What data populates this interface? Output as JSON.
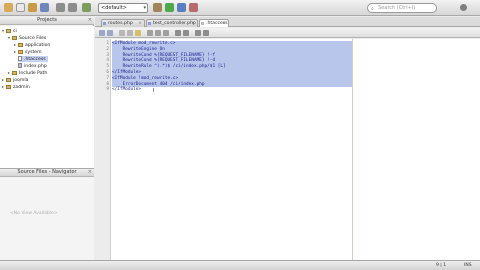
{
  "toolbar": {
    "config_select": "<default>",
    "search_placeholder": "Search (Ctrl+I)"
  },
  "projects_panel": {
    "title": "Projects",
    "tree": [
      {
        "label": "ci",
        "kind": "project",
        "depth": 0,
        "expanded": true
      },
      {
        "label": "Source Files",
        "kind": "folder",
        "depth": 1,
        "expanded": true
      },
      {
        "label": "application",
        "kind": "folder",
        "depth": 2,
        "expanded": false
      },
      {
        "label": "system",
        "kind": "folder",
        "depth": 2,
        "expanded": false
      },
      {
        "label": ".htaccess",
        "kind": "file",
        "depth": 2,
        "selected": true
      },
      {
        "label": "index.php",
        "kind": "file",
        "depth": 2
      },
      {
        "label": "Include Path",
        "kind": "folder",
        "depth": 1,
        "expanded": false
      },
      {
        "label": "joomla",
        "kind": "project",
        "depth": 0,
        "expanded": false
      },
      {
        "label": "zadmin",
        "kind": "project",
        "depth": 0,
        "expanded": false
      }
    ]
  },
  "navigator_panel": {
    "title": "Source Files - Navigator",
    "empty_text": "<No View Available>"
  },
  "tabs": [
    {
      "label": "routes.php",
      "active": false
    },
    {
      "label": "test_controller.php",
      "active": false
    },
    {
      "label": ".htaccess",
      "active": true
    }
  ],
  "editor": {
    "line_numbers": [
      "1",
      "2",
      "3",
      "4",
      "5",
      "6",
      "7",
      "8",
      "9"
    ],
    "lines": [
      "<IfModule mod_rewrite.c>",
      "    RewriteEngine On",
      "    RewriteCond %{REQUEST_FILENAME} !-f",
      "    RewriteCond %{REQUEST_FILENAME} !-d",
      "    RewriteRule ^(.*)$ /ci/index.php/$1 [L]",
      "</IfModule>",
      "<IfModule !mod_rewrite.c>",
      "    ErrorDocument 404 /ci/index.php",
      "</IfModule>"
    ],
    "selection_color": "#b8c6ec"
  },
  "statusbar": {
    "position": "9 | 1",
    "mode": "INS"
  }
}
